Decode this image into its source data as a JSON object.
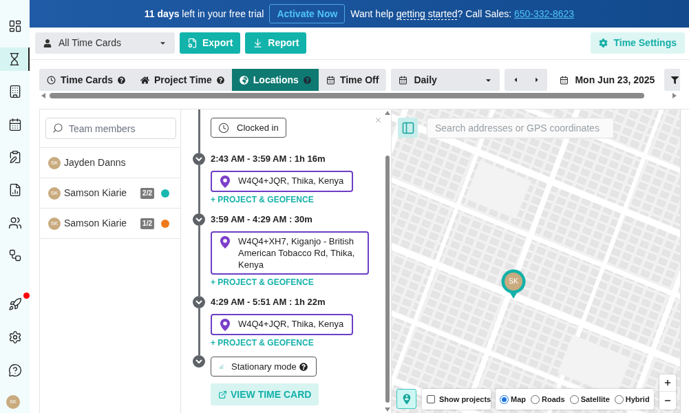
{
  "sidebar": {
    "items": [
      {
        "selected": false,
        "notification": false
      },
      {
        "selected": true,
        "notification": false
      },
      {
        "selected": false,
        "notification": false
      },
      {
        "selected": false,
        "notification": false
      },
      {
        "selected": false,
        "notification": false
      },
      {
        "selected": false,
        "notification": false
      },
      {
        "selected": false,
        "notification": false
      },
      {
        "selected": false,
        "notification": false
      },
      {
        "selected": false,
        "notification": true
      },
      {
        "selected": false,
        "notification": false
      },
      {
        "selected": false,
        "notification": false
      }
    ],
    "user_initials": "SK"
  },
  "banner": {
    "trial": "**11 days** left in your free trial",
    "action": "Activate Now",
    "help_before": "Want help",
    "help_link": "getting started",
    "sales": "? Call Sales:",
    "phone": "650-332-8623"
  },
  "toolbar": {
    "time_cards_select": {
      "value": "All Time Cards"
    },
    "buttons": [
      {
        "label": "Export"
      },
      {
        "label": "Report"
      }
    ],
    "settings_button": {
      "label": "Time Settings"
    }
  },
  "tabs": [
    {
      "label": "Time Cards",
      "help": true,
      "selected": false
    },
    {
      "label": "Project Time",
      "help": true,
      "selected": false
    },
    {
      "label": "Locations",
      "help": true,
      "selected": true
    },
    {
      "label": "Time Off",
      "help": false,
      "selected": false
    }
  ],
  "period_select": {
    "value": "Daily"
  },
  "date": {
    "value": "Mon Jun 23, 2025"
  },
  "team": {
    "search": {
      "placeholder": "Team members"
    },
    "members": [
      {
        "name": "Jayden Danns",
        "initials": "SK"
      },
      {
        "name": "Samson Kiarie",
        "initials": "SK",
        "count": "2/2",
        "color": "#17b8b0"
      },
      {
        "name": "Samson Kiarie",
        "initials": "SK",
        "count": "1/2",
        "color": "#f07a1a"
      }
    ]
  },
  "timeline": {
    "status_start": "Clocked in",
    "segments": [
      {
        "time": "2:43 AM - 3:59 AM : 1h 16m",
        "address": "W4Q4+JQR, Thika, Kenya",
        "action": "+ PROJECT & GEOFENCE"
      },
      {
        "time": "3:59 AM - 4:29 AM : 30m",
        "address": "W4Q4+XH7, Kiganjo - British American Tobacco Rd, Thika, Kenya",
        "action": "+ PROJECT & GEOFENCE"
      },
      {
        "time": "4:29 AM - 5:51 AM : 1h 22m",
        "address": "W4Q4+JQR, Thika, Kenya",
        "action": "+ PROJECT & GEOFENCE"
      }
    ],
    "status_end": "Stationary mode",
    "view_button": "VIEW TIME CARD"
  },
  "map": {
    "search": {
      "placeholder": "Search addresses or GPS coordinates"
    },
    "marker": {
      "initials": "SK"
    },
    "show_projects": {
      "label": "Show projects",
      "checked": false
    },
    "map_types": [
      {
        "label": "Map",
        "selected": true
      },
      {
        "label": "Roads",
        "selected": false
      },
      {
        "label": "Satellite",
        "selected": false
      },
      {
        "label": "Hybrid",
        "selected": false
      }
    ]
  }
}
